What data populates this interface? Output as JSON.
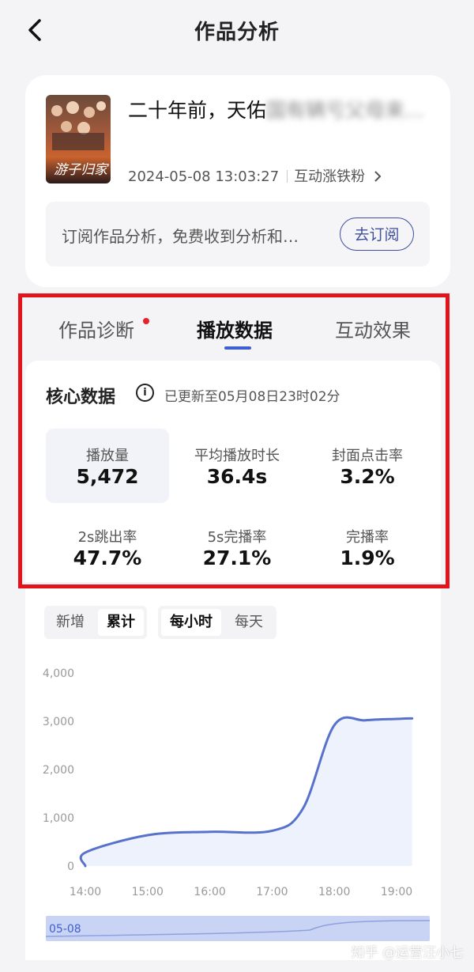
{
  "header": {
    "title": "作品分析"
  },
  "video": {
    "title_visible": "二十年前，天佑",
    "title_blurred": "国有辆亏父母来…",
    "published": "2024-05-08 13:03:27",
    "tag": "互动涨铁粉",
    "cover_text": "游子归家"
  },
  "subscribe": {
    "text": "订阅作品分析，免费收到分析和…",
    "button": "去订阅"
  },
  "tabs": [
    {
      "label": "作品诊断"
    },
    {
      "label": "播放数据"
    },
    {
      "label": "互动效果"
    }
  ],
  "core": {
    "title": "核心数据",
    "info_glyph": "i",
    "updated": "已更新至05月08日23时02分",
    "metrics": [
      {
        "label": "播放量",
        "value": "5,472"
      },
      {
        "label": "平均播放时长",
        "value": "36.4s"
      },
      {
        "label": "封面点击率",
        "value": "3.2%"
      },
      {
        "label": "2s跳出率",
        "value": "47.7%"
      },
      {
        "label": "5s完播率",
        "value": "27.1%"
      },
      {
        "label": "完播率",
        "value": "1.9%"
      }
    ]
  },
  "chart_controls": {
    "mode": [
      "新增",
      "累计"
    ],
    "granularity": [
      "每小时",
      "每天"
    ]
  },
  "chart_data": {
    "type": "area",
    "x": [
      "13:00",
      "14:00",
      "15:00",
      "16:00",
      "17:00",
      "17:30",
      "18:00",
      "18:30",
      "19:00",
      "19:15"
    ],
    "values": [
      0,
      280,
      640,
      710,
      730,
      1200,
      2920,
      3020,
      3050,
      3060
    ],
    "xticks": [
      "14:00",
      "15:00",
      "16:00",
      "17:00",
      "18:00",
      "19:00"
    ],
    "yticks": [
      "0",
      "1,000",
      "2,000",
      "3,000",
      "4,000"
    ],
    "ylim": [
      0,
      4000
    ],
    "line_color": "#5872cc",
    "fill_color": "#eef2fc",
    "range_label": "05-08"
  },
  "watermark": "知乎 @运营汪小七",
  "colors": {
    "accent": "#3e5fd4",
    "highlight_box": "#e3131b",
    "badge_dot": "#e3242b"
  }
}
